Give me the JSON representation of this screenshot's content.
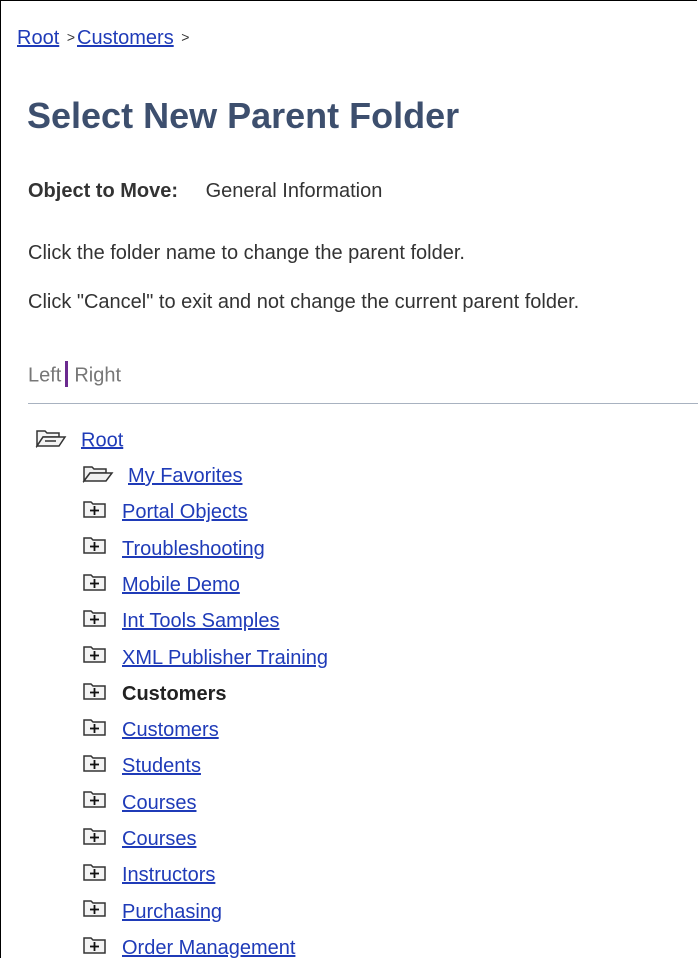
{
  "breadcrumb": {
    "items": [
      "Root",
      "Customers"
    ],
    "separator": ">"
  },
  "page": {
    "title": "Select New Parent Folder",
    "object_label": "Object to Move:",
    "object_value": "General Information",
    "instruction_1": "Click the folder name to change the parent folder.",
    "instruction_2": "Click \"Cancel\" to exit and not change the current parent folder."
  },
  "view_toggle": {
    "left": "Left",
    "right": "Right"
  },
  "tree": {
    "root": {
      "label": "Root",
      "icon": "open-folder-icon"
    },
    "children": [
      {
        "label": "My Favorites",
        "icon": "open-folder-icon",
        "link": true
      },
      {
        "label": "Portal Objects",
        "icon": "plus-folder-icon",
        "link": true
      },
      {
        "label": "Troubleshooting",
        "icon": "plus-folder-icon",
        "link": true
      },
      {
        "label": "Mobile Demo",
        "icon": "plus-folder-icon",
        "link": true
      },
      {
        "label": "Int Tools Samples",
        "icon": "plus-folder-icon",
        "link": true
      },
      {
        "label": "XML Publisher Training",
        "icon": "plus-folder-icon",
        "link": true
      },
      {
        "label": "Customers",
        "icon": "plus-folder-icon",
        "link": false
      },
      {
        "label": "Customers",
        "icon": "plus-folder-icon",
        "link": true
      },
      {
        "label": "Students",
        "icon": "plus-folder-icon",
        "link": true
      },
      {
        "label": "Courses",
        "icon": "plus-folder-icon",
        "link": true
      },
      {
        "label": "Courses",
        "icon": "plus-folder-icon",
        "link": true
      },
      {
        "label": "Instructors",
        "icon": "plus-folder-icon",
        "link": true
      },
      {
        "label": "Purchasing",
        "icon": "plus-folder-icon",
        "link": true
      },
      {
        "label": "Order Management",
        "icon": "plus-folder-icon",
        "link": true
      }
    ]
  },
  "colors": {
    "link": "#1f3bb8",
    "title": "#3d4f6e",
    "toggle_bar": "#6b2a8f"
  }
}
